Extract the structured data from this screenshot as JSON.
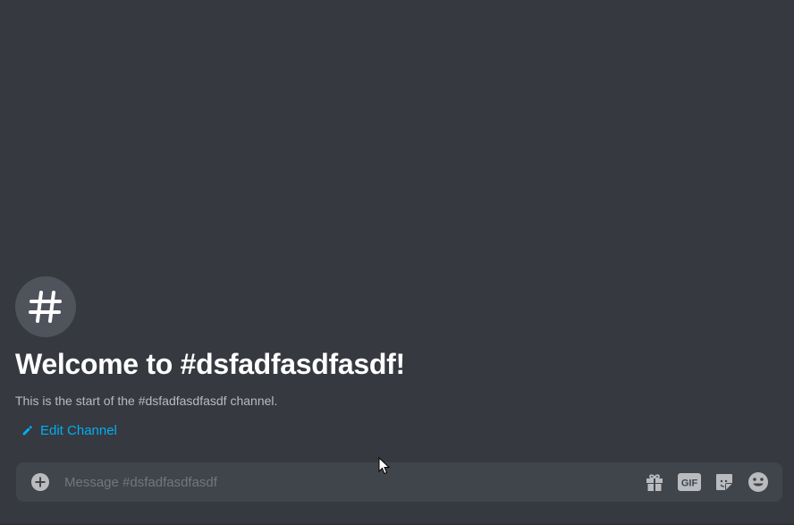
{
  "channel": {
    "welcome_title": "Welcome to #dsfadfasdfasdf!",
    "welcome_subtitle": "This is the start of the #dsfadfasdfasdf channel.",
    "edit_label": "Edit Channel",
    "icon": "hash-icon"
  },
  "composer": {
    "placeholder": "Message #dsfadfasdfasdf",
    "value": "",
    "attach_icon": "plus-circle-icon",
    "actions": [
      {
        "name": "gift-icon"
      },
      {
        "name": "gif-icon",
        "label": "GIF"
      },
      {
        "name": "sticker-icon"
      },
      {
        "name": "emoji-icon"
      }
    ]
  },
  "colors": {
    "background": "#36393f",
    "composer": "#40444b",
    "link": "#00aff4",
    "heading": "#ffffff",
    "muted": "#b9bbbe",
    "icon": "#b9bbbe"
  }
}
